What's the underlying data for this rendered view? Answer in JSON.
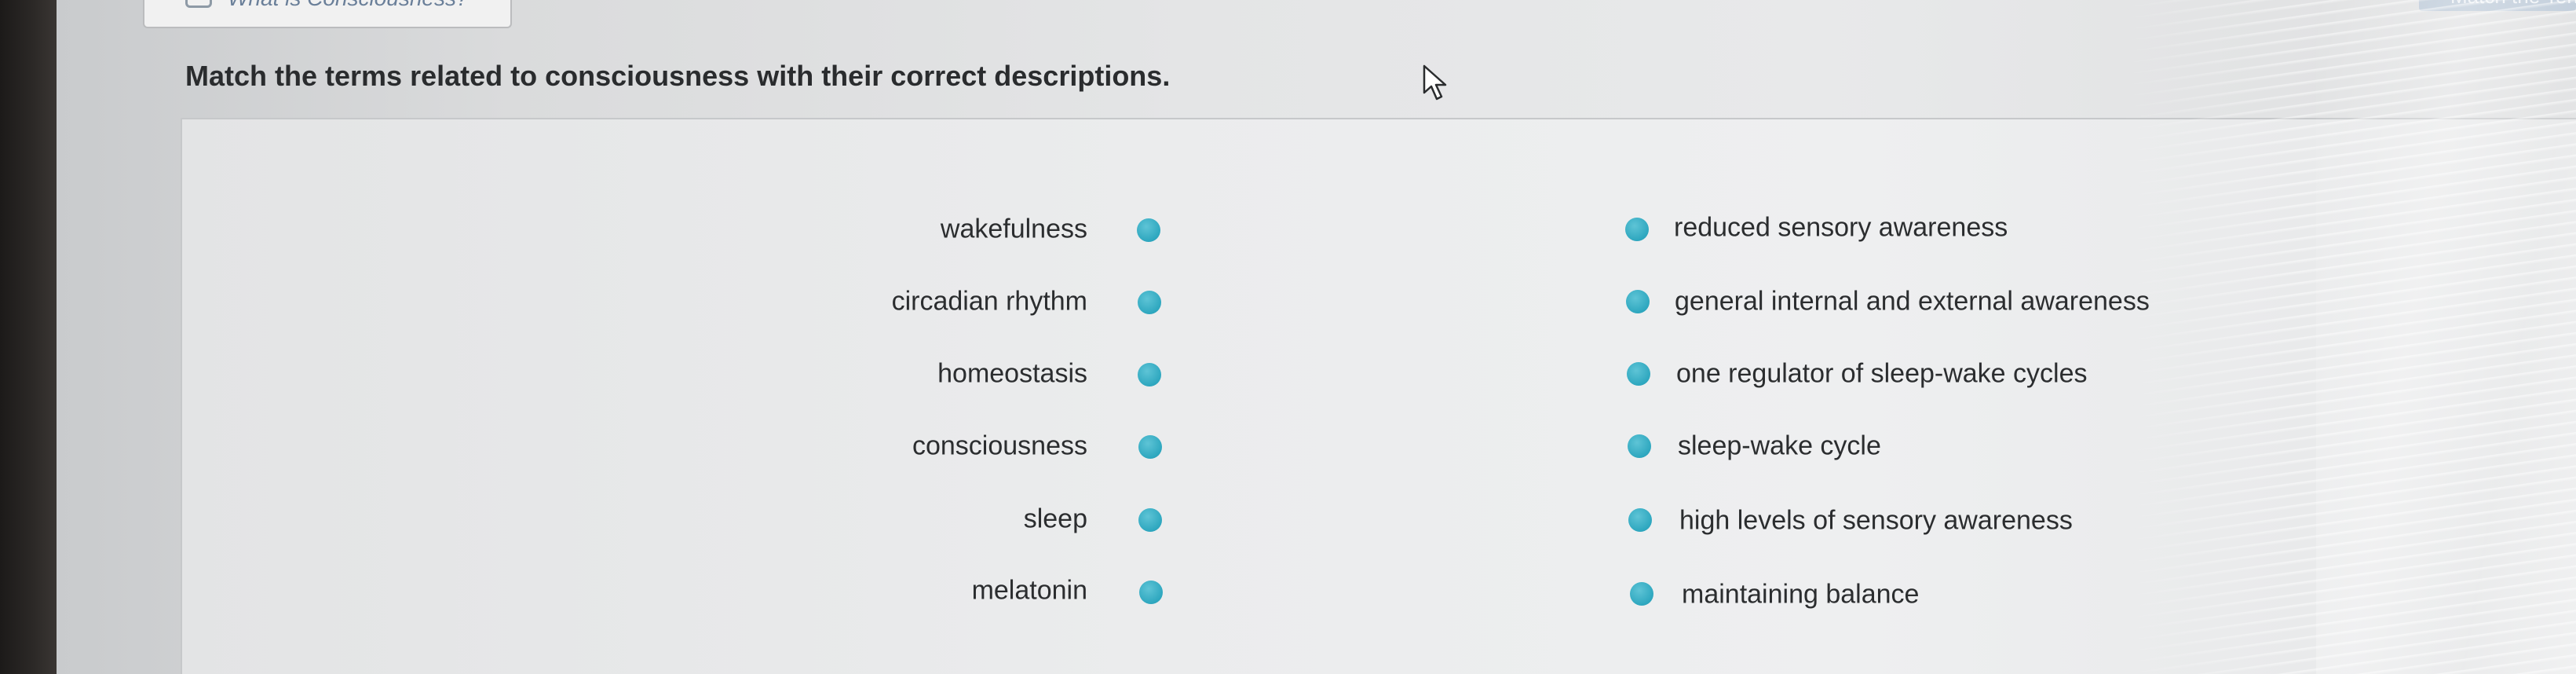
{
  "header": {
    "tab_label": "What is Consciousness?",
    "top_right_label": "Match the Terms"
  },
  "question": {
    "prompt": "Match the terms related to consciousness with their correct descriptions."
  },
  "terms": [
    {
      "label": "wakefulness"
    },
    {
      "label": "circadian rhythm"
    },
    {
      "label": "homeostasis"
    },
    {
      "label": "consciousness"
    },
    {
      "label": "sleep"
    },
    {
      "label": "melatonin"
    }
  ],
  "descriptions": [
    {
      "label": "reduced sensory awareness"
    },
    {
      "label": "general internal and external awareness"
    },
    {
      "label": "one regulator of sleep-wake cycles"
    },
    {
      "label": "sleep-wake cycle"
    },
    {
      "label": "high levels of sensory awareness"
    },
    {
      "label": "maintaining balance"
    }
  ],
  "colors": {
    "connector_dot": "#2ea7bf",
    "question_text": "#2a2c2e",
    "panel_bg": "#ebeced"
  },
  "icons": {
    "cursor": "mouse-pointer-icon",
    "tab": "book-icon"
  }
}
